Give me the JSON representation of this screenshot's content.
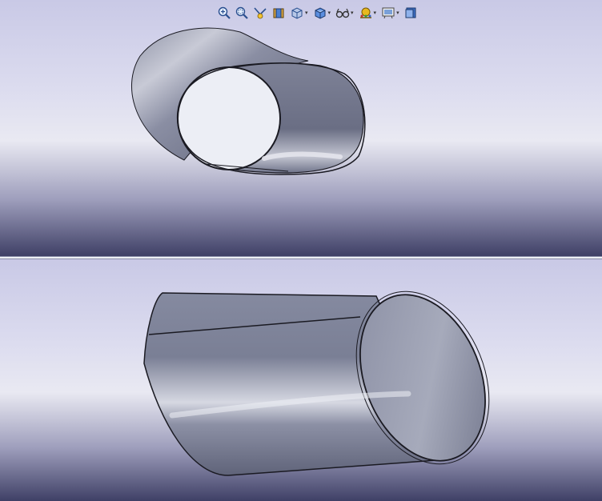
{
  "toolbar": {
    "buttons": [
      {
        "name": "zoom-to-fit-icon",
        "dropdown": false
      },
      {
        "name": "zoom-to-area-icon",
        "dropdown": false
      },
      {
        "name": "previous-view-icon",
        "dropdown": false
      },
      {
        "name": "section-view-icon",
        "dropdown": false
      },
      {
        "name": "view-orientation-icon",
        "dropdown": true
      },
      {
        "name": "display-style-icon",
        "dropdown": true
      },
      {
        "name": "hide-show-items-icon",
        "dropdown": true
      },
      {
        "name": "edit-appearance-icon",
        "dropdown": true
      },
      {
        "name": "apply-scene-icon",
        "dropdown": true
      },
      {
        "name": "view-settings-icon",
        "dropdown": false
      }
    ],
    "dropdown_glyph": "▾"
  },
  "colors": {
    "background_top": "#c9c9e6",
    "background_bottom": "#3f4066",
    "model_surface": "#7b7f93",
    "model_highlight": "#d4d6df",
    "model_edge": "#1a1a22"
  }
}
